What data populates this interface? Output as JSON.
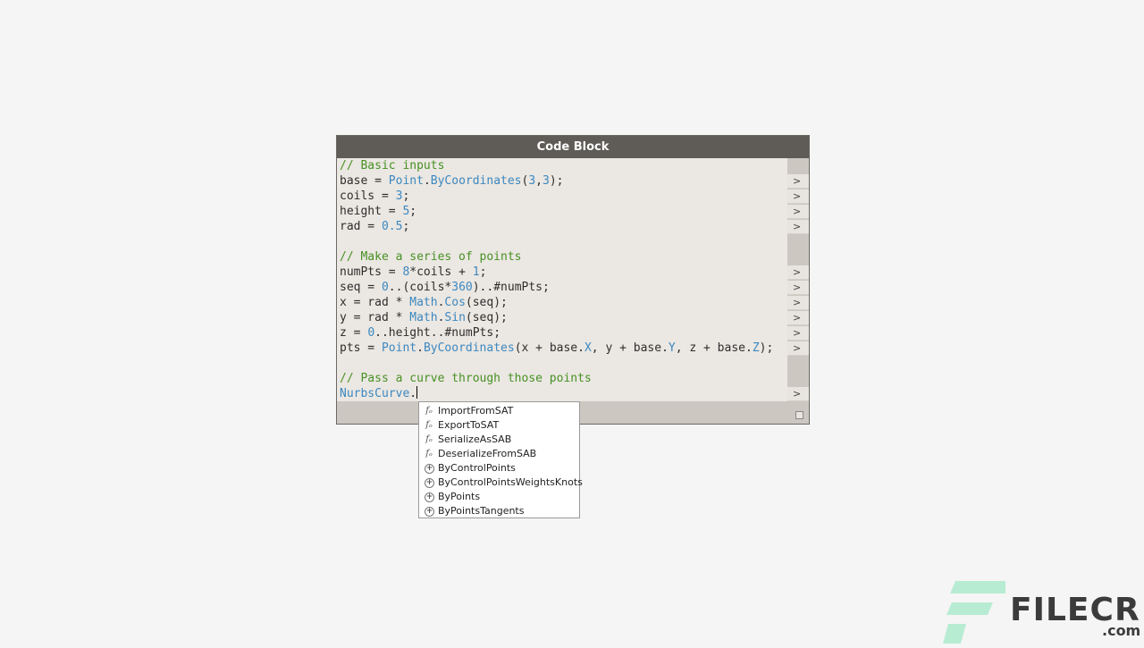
{
  "node": {
    "title": "Code Block"
  },
  "code": {
    "lines": [
      {
        "parts": [
          {
            "t": "// Basic inputs",
            "c": "c"
          }
        ]
      },
      {
        "parts": [
          {
            "t": "base = "
          },
          {
            "t": "Point",
            "c": "k"
          },
          {
            "t": "."
          },
          {
            "t": "ByCoordinates",
            "c": "k"
          },
          {
            "t": "("
          },
          {
            "t": "3",
            "c": "n"
          },
          {
            "t": ","
          },
          {
            "t": "3",
            "c": "n"
          },
          {
            "t": ");"
          }
        ]
      },
      {
        "parts": [
          {
            "t": "coils = "
          },
          {
            "t": "3",
            "c": "n"
          },
          {
            "t": ";"
          }
        ]
      },
      {
        "parts": [
          {
            "t": "height = "
          },
          {
            "t": "5",
            "c": "n"
          },
          {
            "t": ";"
          }
        ]
      },
      {
        "parts": [
          {
            "t": "rad = "
          },
          {
            "t": "0.5",
            "c": "n"
          },
          {
            "t": ";"
          }
        ]
      },
      {
        "parts": []
      },
      {
        "parts": [
          {
            "t": "// Make a series of points",
            "c": "c"
          }
        ]
      },
      {
        "parts": [
          {
            "t": "numPts = "
          },
          {
            "t": "8",
            "c": "n"
          },
          {
            "t": "*coils + "
          },
          {
            "t": "1",
            "c": "n"
          },
          {
            "t": ";"
          }
        ]
      },
      {
        "parts": [
          {
            "t": "seq = "
          },
          {
            "t": "0",
            "c": "n"
          },
          {
            "t": "..(coils*"
          },
          {
            "t": "360",
            "c": "n"
          },
          {
            "t": ")..#numPts;"
          }
        ]
      },
      {
        "parts": [
          {
            "t": "x = rad * "
          },
          {
            "t": "Math",
            "c": "k"
          },
          {
            "t": "."
          },
          {
            "t": "Cos",
            "c": "k"
          },
          {
            "t": "(seq);"
          }
        ]
      },
      {
        "parts": [
          {
            "t": "y = rad * "
          },
          {
            "t": "Math",
            "c": "k"
          },
          {
            "t": "."
          },
          {
            "t": "Sin",
            "c": "k"
          },
          {
            "t": "(seq);"
          }
        ]
      },
      {
        "parts": [
          {
            "t": "z = "
          },
          {
            "t": "0",
            "c": "n"
          },
          {
            "t": "..height..#numPts;"
          }
        ]
      },
      {
        "parts": [
          {
            "t": "pts = "
          },
          {
            "t": "Point",
            "c": "k"
          },
          {
            "t": "."
          },
          {
            "t": "ByCoordinates",
            "c": "k"
          },
          {
            "t": "(x + base."
          },
          {
            "t": "X",
            "c": "k"
          },
          {
            "t": ", y + base."
          },
          {
            "t": "Y",
            "c": "k"
          },
          {
            "t": ", z + base."
          },
          {
            "t": "Z",
            "c": "k"
          },
          {
            "t": ");"
          }
        ]
      },
      {
        "parts": []
      },
      {
        "parts": [
          {
            "t": "// Pass a curve through those points",
            "c": "c"
          }
        ]
      },
      {
        "parts": [
          {
            "t": "NurbsCurve",
            "c": "k"
          },
          {
            "t": "."
          }
        ],
        "caret": true
      }
    ]
  },
  "ports": {
    "label": ">",
    "rows": [
      1,
      2,
      3,
      4,
      7,
      8,
      9,
      10,
      11,
      12,
      15
    ]
  },
  "autocomplete": {
    "items": [
      {
        "label": "ImportFromSAT",
        "icon": "function-icon"
      },
      {
        "label": "ExportToSAT",
        "icon": "function-icon"
      },
      {
        "label": "SerializeAsSAB",
        "icon": "function-icon"
      },
      {
        "label": "DeserializeFromSAB",
        "icon": "function-icon"
      },
      {
        "label": "ByControlPoints",
        "icon": "create-icon"
      },
      {
        "label": "ByControlPointsWeightsKnots",
        "icon": "create-icon"
      },
      {
        "label": "ByPoints",
        "icon": "create-icon"
      },
      {
        "label": "ByPointsTangents",
        "icon": "create-icon"
      }
    ]
  },
  "watermark": {
    "brand": "FILECR",
    "suffix": ".com",
    "colors": {
      "mark": "#b7ecd3",
      "text": "#3b3b3b"
    }
  }
}
